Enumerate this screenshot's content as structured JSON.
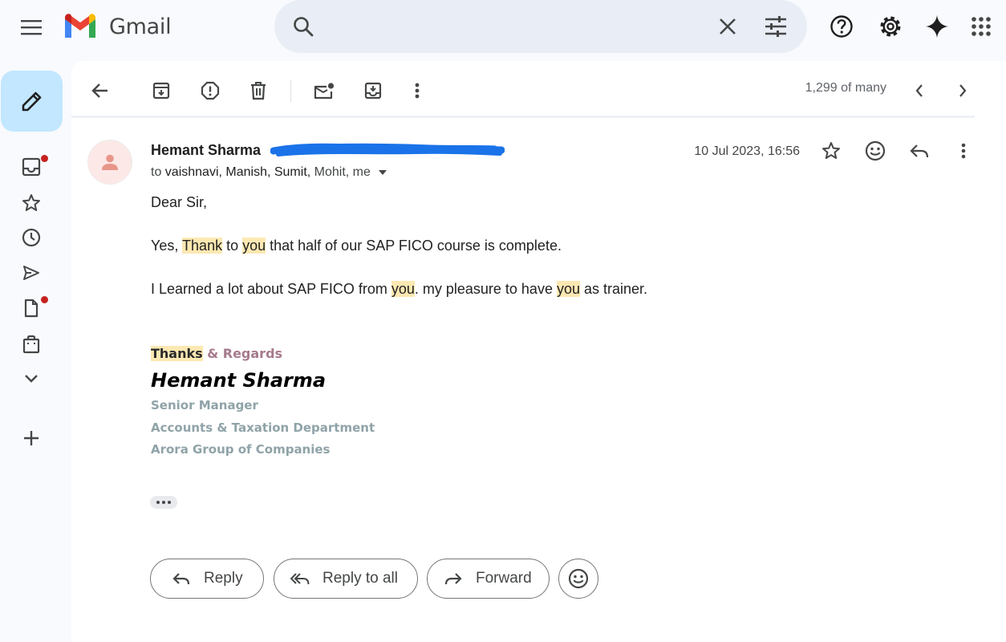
{
  "app": {
    "title": "Gmail"
  },
  "search": {
    "value": "",
    "placeholder": ""
  },
  "toolbar": {
    "pager": "1,299 of many"
  },
  "email": {
    "sender": "Hemant Sharma",
    "recipients_prefix": "to ",
    "recipients_bold": "vaishnavi, Manish, Sumit,",
    "recipients_rest": " Mohit, me",
    "date": "10 Jul 2023, 16:56",
    "body": {
      "greeting": "Dear Sir,",
      "line1": {
        "a": "Yes, ",
        "b": "Thank",
        "c": " to ",
        "d": "you",
        "e": " that half of our SAP FICO course is complete."
      },
      "line2": {
        "a": "I Learned a lot about SAP FICO from ",
        "b": "you",
        "c": ". my pleasure to have ",
        "d": "you",
        "e": " as trainer."
      }
    },
    "signature": {
      "thanks": "Thanks",
      "regards": " & Regards",
      "name": "Hemant Sharma",
      "title": "Senior Manager",
      "department": "Accounts & Taxation Department",
      "company": "Arora Group of Companies"
    }
  },
  "actions": {
    "reply": "Reply",
    "reply_all": "Reply to all",
    "forward": "Forward"
  },
  "colors": {
    "accent": "#c2e7ff",
    "highlight": "#fce8b2",
    "badge": "#c5221f",
    "redaction": "#1a73e8"
  }
}
